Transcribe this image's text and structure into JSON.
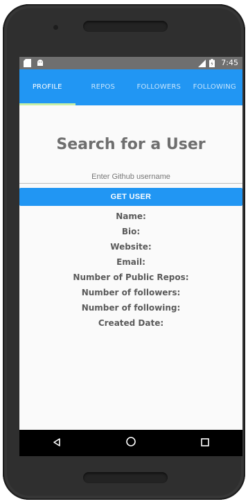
{
  "status_bar": {
    "time": "7:45",
    "left_icons": [
      "sd-card-icon",
      "android-icon"
    ],
    "right_icons": [
      "signal-icon",
      "battery-icon"
    ],
    "background_color": "#6f6f6f"
  },
  "tabs": [
    {
      "label": "PROFILE",
      "active": true
    },
    {
      "label": "REPOS",
      "active": false
    },
    {
      "label": "FOLLOWERS",
      "active": false
    },
    {
      "label": "FOLLOWING",
      "active": false
    }
  ],
  "page": {
    "title": "Search for a User",
    "username_input": {
      "placeholder": "Enter Github username",
      "value": ""
    },
    "get_user_label": "GET USER",
    "accent_color": "#2196F3"
  },
  "profile_fields": [
    {
      "label": "Name:"
    },
    {
      "label": "Bio:"
    },
    {
      "label": "Website:"
    },
    {
      "label": "Email:"
    },
    {
      "label": "Number of Public Repos:"
    },
    {
      "label": "Number of followers:"
    },
    {
      "label": "Number of following:"
    },
    {
      "label": "Created Date:"
    }
  ],
  "navbar": {
    "icons": [
      "back-icon",
      "home-icon",
      "recents-icon"
    ]
  }
}
